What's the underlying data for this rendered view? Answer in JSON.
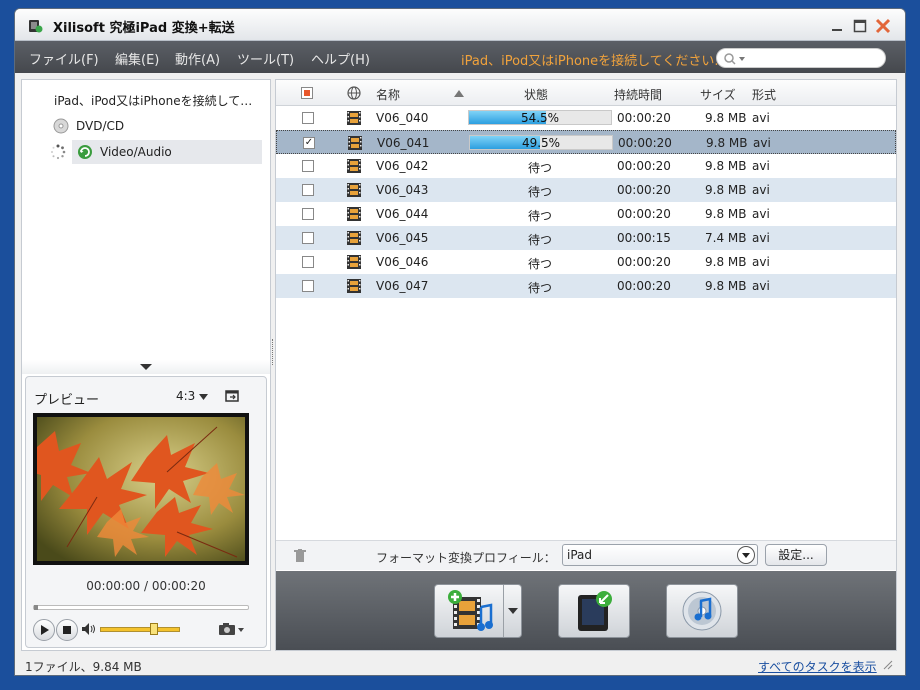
{
  "window": {
    "title": "Xilisoft 究極iPad 変換+転送"
  },
  "menubar": {
    "items": [
      "ファイル(F)",
      "編集(E)",
      "動作(A)",
      "ツール(T)",
      "ヘルプ(H)"
    ],
    "notice": "iPad、iPod又はiPhoneを接続してください..."
  },
  "sidebar": {
    "device_prompt": "iPad、iPod又はiPhoneを接続して…",
    "dvd": "DVD/CD",
    "video_audio": "Video/Audio"
  },
  "preview": {
    "title": "プレビュー",
    "ratio": "4:3",
    "time": "00:00:00 / 00:00:20",
    "volume_level": 0.65
  },
  "table": {
    "headers": {
      "name": "名称",
      "status": "状態",
      "duration": "持続時間",
      "size": "サイズ",
      "format": "形式"
    },
    "rows": [
      {
        "name": "V06_040",
        "status": "54.5%",
        "progress": 0.545,
        "duration": "00:00:20",
        "size": "9.8 MB",
        "format": "avi",
        "checked": false
      },
      {
        "name": "V06_041",
        "status": "49.5%",
        "progress": 0.495,
        "duration": "00:00:20",
        "size": "9.8 MB",
        "format": "avi",
        "checked": true
      },
      {
        "name": "V06_042",
        "status": "待つ",
        "duration": "00:00:20",
        "size": "9.8 MB",
        "format": "avi",
        "checked": false
      },
      {
        "name": "V06_043",
        "status": "待つ",
        "duration": "00:00:20",
        "size": "9.8 MB",
        "format": "avi",
        "checked": false
      },
      {
        "name": "V06_044",
        "status": "待つ",
        "duration": "00:00:20",
        "size": "9.8 MB",
        "format": "avi",
        "checked": false
      },
      {
        "name": "V06_045",
        "status": "待つ",
        "duration": "00:00:15",
        "size": "7.4 MB",
        "format": "avi",
        "checked": false
      },
      {
        "name": "V06_046",
        "status": "待つ",
        "duration": "00:00:20",
        "size": "9.8 MB",
        "format": "avi",
        "checked": false
      },
      {
        "name": "V06_047",
        "status": "待つ",
        "duration": "00:00:20",
        "size": "9.8 MB",
        "format": "avi",
        "checked": false
      }
    ]
  },
  "profile": {
    "label": "フォーマット変換プロフィール：",
    "value": "iPad",
    "settings": "設定..."
  },
  "status": {
    "left": "1ファイル、9.84 MB",
    "right": "すべてのタスクを表示"
  },
  "colors": {
    "accent": "#f0a23c",
    "selected_row": "#a4b6c9",
    "alt_row": "#dce6f0",
    "progress": "#2c9fe0"
  }
}
